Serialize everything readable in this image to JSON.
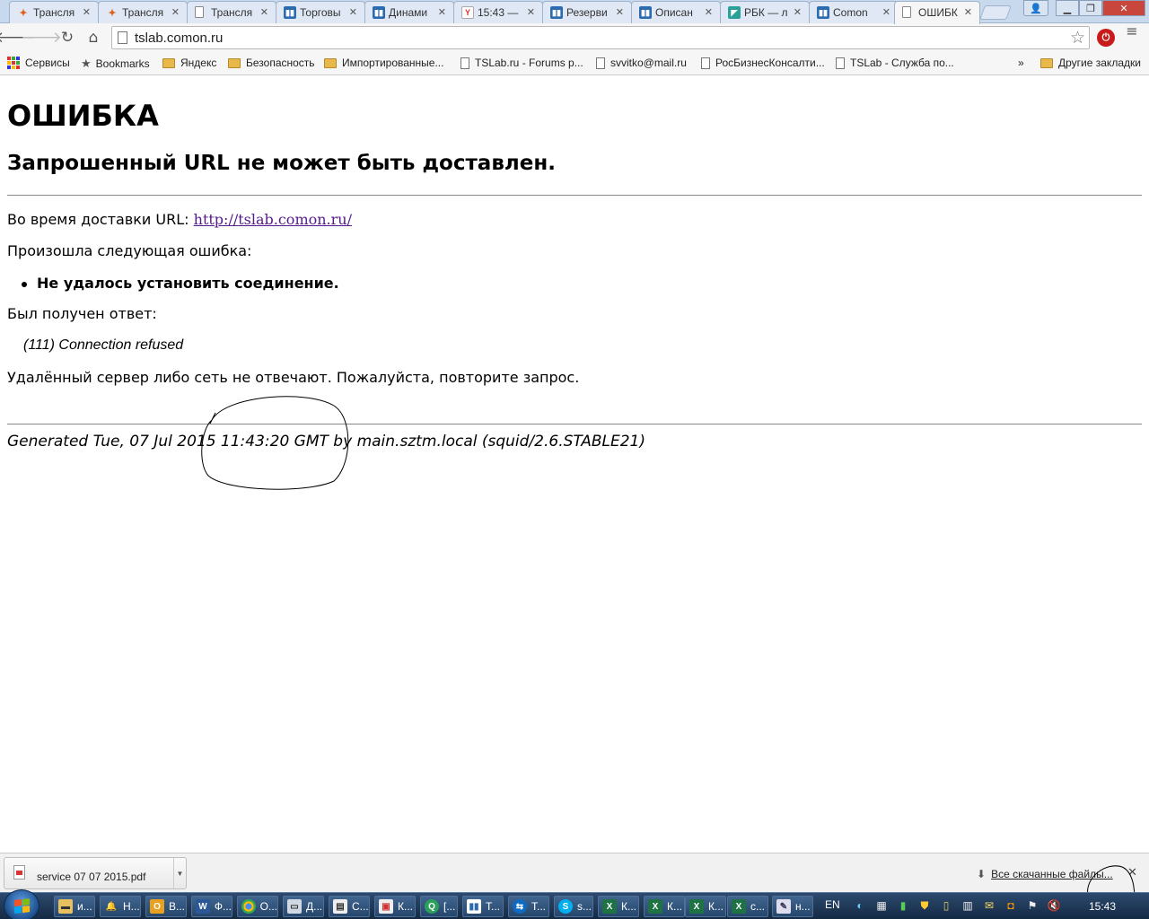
{
  "tabs": [
    {
      "title": "Трансля",
      "icon": "orange-puzzle-icon"
    },
    {
      "title": "Трансля",
      "icon": "orange-puzzle-icon"
    },
    {
      "title": "Трансля",
      "icon": "page-icon"
    },
    {
      "title": "Торговы",
      "icon": "chart-icon"
    },
    {
      "title": "Динами",
      "icon": "chart-icon"
    },
    {
      "title": "15:43 —",
      "icon": "yandex-icon"
    },
    {
      "title": "Резерви",
      "icon": "chart-icon"
    },
    {
      "title": "Описан",
      "icon": "chart-icon"
    },
    {
      "title": "РБК — л",
      "icon": "rbc-icon"
    },
    {
      "title": "Comon",
      "icon": "chart-icon"
    },
    {
      "title": "ОШИБК",
      "icon": "page-icon",
      "active": true
    }
  ],
  "toolbar": {
    "url": "tslab.comon.ru"
  },
  "bookmarks": {
    "items": [
      "Сервисы",
      "Bookmarks",
      "Яндекс",
      "Безопасность",
      "Импортированные...",
      "TSLab.ru - Forums p...",
      "svvitko@mail.ru",
      "РосБизнесКонсалти...",
      "TSLab - Служба по..."
    ],
    "overflow": "»",
    "other": "Другие закладки"
  },
  "page": {
    "heading": "ОШИБКА",
    "subheading": "Запрошенный URL не может быть доставлен.",
    "while_label": "Во время доставки URL: ",
    "link": "http://tslab.comon.ru/",
    "error_intro": "Произошла следующая ошибка:",
    "error_item": "Не удалось установить соединение.",
    "response_label": "Был получен ответ:",
    "response": "(111) Connection refused",
    "advice": "Удалённый сервер либо сеть не отвечают. Пожалуйста, повторите запрос.",
    "footer": "Generated Tue, 07 Jul 2015 11:43:20 GMT by main.sztm.local (squid/2.6.STABLE21)"
  },
  "downloads": {
    "file": "service 07 07 2015.pdf",
    "all_label": "Все скачанные файлы..."
  },
  "taskbar": {
    "buttons": [
      "и...",
      "Н...",
      "В...",
      "Ф...",
      "О...",
      "Д...",
      "С...",
      "К...",
      "[...",
      "Т...",
      "Т...",
      "s...",
      "К...",
      "К...",
      "К...",
      "с...",
      "н..."
    ],
    "lang": "EN",
    "clock": "15:43"
  },
  "colors": {
    "link_visited": "#551a8b",
    "tab_strip": "#c8d9ee",
    "taskbar": "#1e3756"
  }
}
